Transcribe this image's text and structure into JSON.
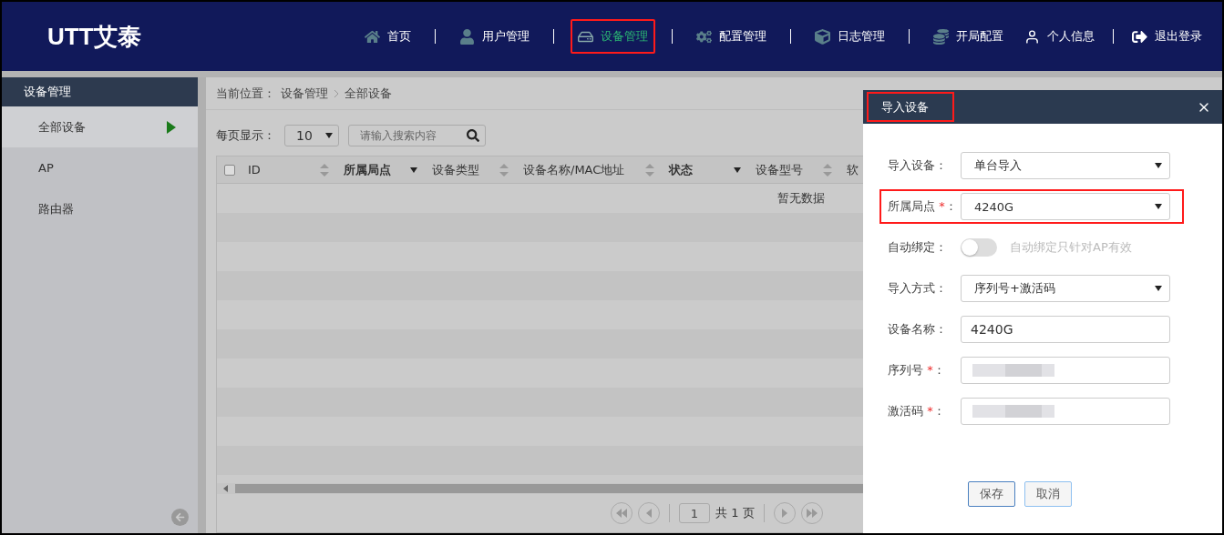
{
  "brand": "UTT艾泰",
  "nav": [
    {
      "label": "首页",
      "selected": false,
      "highlighted": false
    },
    {
      "label": "用户管理",
      "selected": false,
      "highlighted": false
    },
    {
      "label": "设备管理",
      "selected": true,
      "highlighted": true
    },
    {
      "label": "配置管理",
      "selected": false,
      "highlighted": false
    },
    {
      "label": "日志管理",
      "selected": false,
      "highlighted": false
    },
    {
      "label": "开局配置",
      "selected": false,
      "highlighted": false
    }
  ],
  "user_menu": [
    {
      "label": "个人信息"
    },
    {
      "label": "退出登录"
    }
  ],
  "sidebar": {
    "title": "设备管理",
    "items": [
      {
        "label": "全部设备",
        "selected": true
      },
      {
        "label": "AP",
        "selected": false
      },
      {
        "label": "路由器",
        "selected": false
      }
    ]
  },
  "breadcrumb": {
    "prefix": "当前位置：",
    "items": [
      "设备管理",
      "全部设备"
    ]
  },
  "toolbar": {
    "page_size_label": "每页显示：",
    "page_size": "10",
    "search_placeholder": "请输入搜索内容"
  },
  "table": {
    "select_all_checked": false,
    "columns": [
      {
        "label": "ID",
        "kind": "sort"
      },
      {
        "label": "所属局点",
        "kind": "filter"
      },
      {
        "label": "设备类型",
        "kind": "sort"
      },
      {
        "label": "设备名称/MAC地址",
        "kind": "sort"
      },
      {
        "label": "状态",
        "kind": "filter"
      },
      {
        "label": "设备型号",
        "kind": "sort"
      },
      {
        "label": "软",
        "kind": "plain"
      }
    ],
    "empty_text": "暂无数据"
  },
  "pagination": {
    "page": "1",
    "total": "共 1 页"
  },
  "dialog": {
    "title": "导入设备",
    "highlighted": true,
    "fields": [
      {
        "kind": "select",
        "label": "导入设备：",
        "value": "单台导入"
      },
      {
        "kind": "select",
        "label": "所属局点",
        "required_mark": "*",
        "colon": "：",
        "value": "4240G",
        "highlighted": true
      },
      {
        "kind": "toggle",
        "label": "自动绑定：",
        "on": false,
        "hint": "自动绑定只针对AP有效"
      },
      {
        "kind": "select",
        "label": "导入方式：",
        "value": "序列号+激活码"
      },
      {
        "kind": "input",
        "label": "设备名称：",
        "value": "4240G"
      },
      {
        "kind": "input",
        "label": "序列号",
        "required_mark": "*",
        "colon": "：",
        "redacted": true
      },
      {
        "kind": "input",
        "label": "激活码",
        "required_mark": "*",
        "colon": "：",
        "redacted": true
      }
    ],
    "buttons": [
      {
        "label": "保存",
        "kind": "primary"
      },
      {
        "label": "取消",
        "kind": "secondary"
      }
    ]
  }
}
